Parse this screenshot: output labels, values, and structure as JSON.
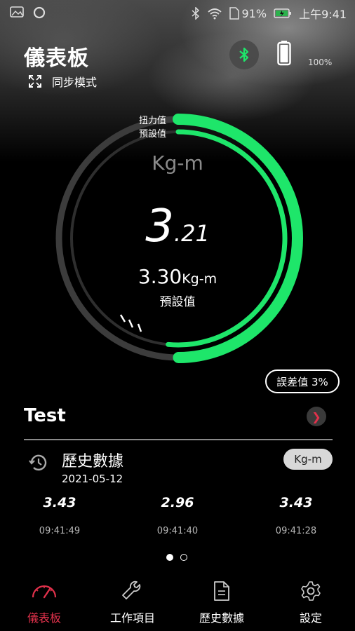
{
  "status_bar": {
    "signal": "91%",
    "time": "上午9:41"
  },
  "header": {
    "title": "儀表板",
    "sync_mode": "同步模式",
    "battery_percent": "100%"
  },
  "gauge": {
    "legend_torque": "扭力值",
    "legend_preset": "預設值",
    "unit": "Kg-m",
    "value_int": "3",
    "value_dec": ".21",
    "preset_num": "3.30",
    "preset_unit": "Kg-m",
    "preset_label": "預設值",
    "torque_fraction": 0.97,
    "preset_fraction": 1.0
  },
  "tolerance": "誤差值 3%",
  "section": {
    "title": "Test"
  },
  "history": {
    "title": "歷史數據",
    "date": "2021-05-12",
    "unit": "Kg-m",
    "readings": [
      {
        "value": "3.43",
        "time": "09:41:49"
      },
      {
        "value": "2.96",
        "time": "09:41:40"
      },
      {
        "value": "3.43",
        "time": "09:41:28"
      }
    ]
  },
  "pager": {
    "count": 2,
    "active": 0
  },
  "tabs": [
    {
      "label": "儀表板",
      "icon": "speedometer-icon",
      "active": true
    },
    {
      "label": "工作項目",
      "icon": "wrench-icon",
      "active": false
    },
    {
      "label": "歷史數據",
      "icon": "document-icon",
      "active": false
    },
    {
      "label": "設定",
      "icon": "gear-icon",
      "active": false
    }
  ],
  "colors": {
    "accent_green": "#1ee66a",
    "track_gray": "#3c3c3c",
    "active_tab": "#e0314b"
  }
}
